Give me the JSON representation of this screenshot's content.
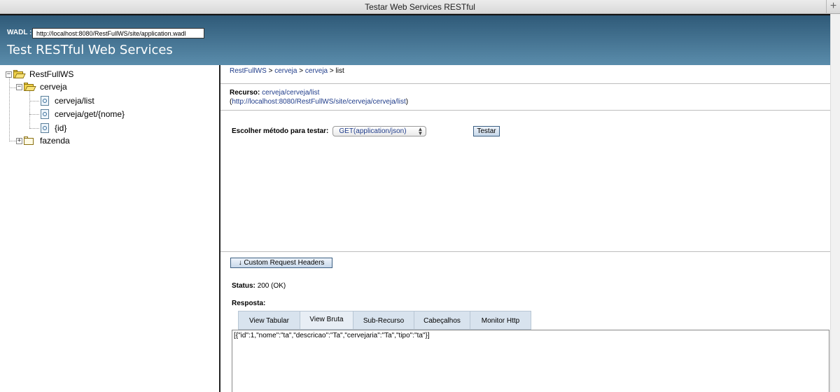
{
  "window": {
    "title": "Testar Web Services RESTful"
  },
  "header": {
    "wadl_label": "WADL :",
    "wadl_url": "http://localhost:8080/RestFullWS/site/application.wadl",
    "app_title": "Test RESTful Web Services"
  },
  "tree": {
    "root": "RestFullWS",
    "cerveja": "cerveja",
    "leaves": [
      "cerveja/list",
      "cerveja/get/{nome}",
      "{id}"
    ],
    "fazenda": "fazenda"
  },
  "breadcrumb": {
    "items": [
      "RestFullWS",
      "cerveja",
      "cerveja",
      "list"
    ],
    "separator": ">"
  },
  "resource": {
    "label": "Recurso:",
    "path": "cerveja/cerveja/list",
    "url": "http://localhost:8080/RestFullWS/site/cerveja/cerveja/list",
    "open_paren": "(",
    "close_paren": ")"
  },
  "method": {
    "label": "Escolher método para testar:",
    "selected": "GET(application/json)",
    "test_button": "Testar"
  },
  "custom_headers_button": "↓ Custom Request Headers",
  "status": {
    "label": "Status:",
    "value": "200 (OK)"
  },
  "response": {
    "label": "Resposta:",
    "tabs": [
      "View Tabular",
      "View Bruta",
      "Sub-Recurso",
      "Cabeçalhos",
      "Monitor Http"
    ],
    "active_tab": 1,
    "body": "[{\"id\":1,\"nome\":\"ta\",\"descricao\":\"Ta\",\"cervejaria\":\"Ta\",\"tipo\":\"ta\"}]"
  }
}
